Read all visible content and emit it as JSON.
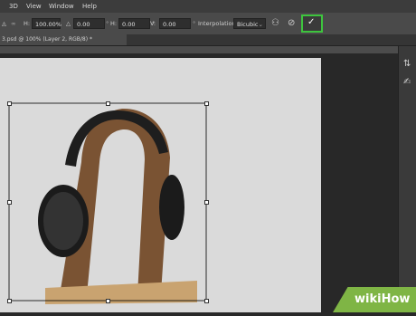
{
  "menu": [
    "3D",
    "View",
    "Window",
    "Help"
  ],
  "options": {
    "h_label": "H:",
    "h_value": "100.00%",
    "angle_value": "0.00",
    "hskew_label": "H:",
    "hskew_value": "0.00",
    "vskew_label": "V:",
    "vskew_value": "0.00",
    "interp_label": "Interpolation:",
    "interp_value": "Bicubic",
    "commit_highlight_color": "#3ec43e"
  },
  "document_tab": {
    "label": "3.psd @ 100% (Layer 2, RGB/8) *"
  },
  "watermark": {
    "text": "wikiHow"
  }
}
